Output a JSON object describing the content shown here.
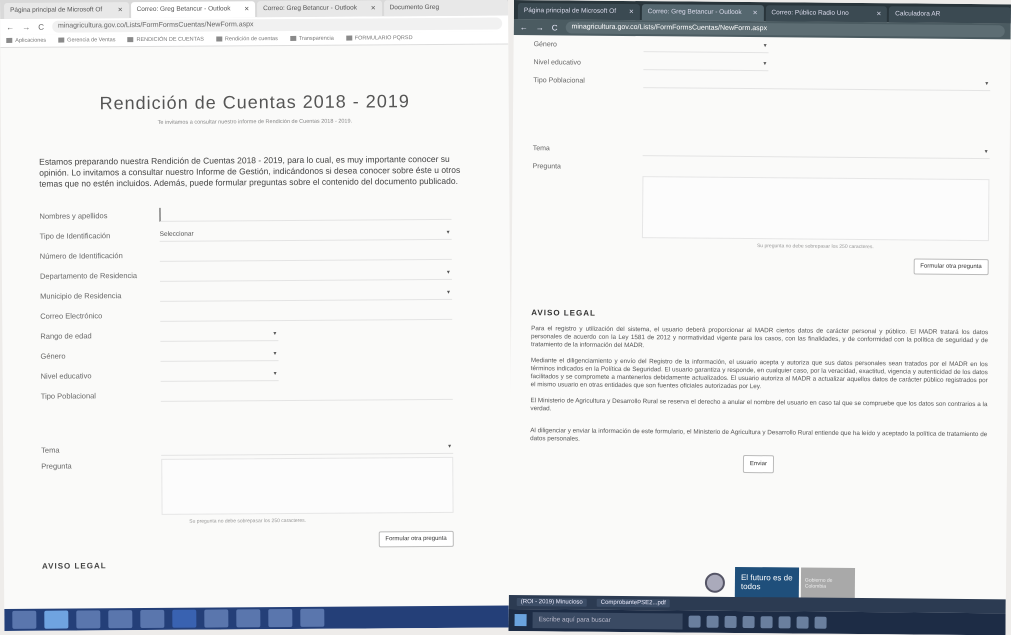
{
  "left": {
    "tabs": [
      {
        "label": "Página principal de Microsoft Of",
        "active": false
      },
      {
        "label": "Correo: Greg Betancur - Outlook",
        "active": true
      },
      {
        "label": "Correo: Greg Betancur - Outlook",
        "active": false
      },
      {
        "label": "Documento Greg",
        "active": false
      }
    ],
    "url": "minagricultura.gov.co/Lists/FormFormsCuentas/NewForm.aspx",
    "bookmarks": [
      "Aplicaciones",
      "Gerencia de Ventas",
      "RENDICIÓN DE CUENTAS",
      "Rendición de cuentas",
      "Transparencia",
      "FORMULARIO PQRSD"
    ],
    "title": "Rendición de Cuentas 2018 - 2019",
    "subtitle": "Te invitamos a consultar nuestro informe de Rendición de Cuentas 2018 - 2019.",
    "intro": "Estamos preparando nuestra Rendición de Cuentas 2018 - 2019, para lo cual, es muy importante conocer su opinión. Lo invitamos a consultar nuestro Informe de Gestión, indicándonos si desea conocer sobre éste u otros temas que no estén incluidos. Además, puede formular preguntas sobre el contenido del documento publicado.",
    "fields": [
      {
        "label": "Nombres y apellidos",
        "value": ""
      },
      {
        "label": "Tipo de Identificación",
        "value": "Seleccionar"
      },
      {
        "label": "Número de Identificación",
        "value": ""
      },
      {
        "label": "Departamento de Residencia",
        "value": ""
      },
      {
        "label": "Municipio de Residencia",
        "value": ""
      },
      {
        "label": "Correo Electrónico",
        "value": ""
      },
      {
        "label": "Rango de edad",
        "value": ""
      },
      {
        "label": "Género",
        "value": ""
      },
      {
        "label": "Nivel educativo",
        "value": ""
      },
      {
        "label": "Tipo Poblacional",
        "value": ""
      }
    ],
    "tema_label": "Tema",
    "pregunta_label": "Pregunta",
    "counter": "Su pregunta no debe sobrepasar los 250 caracteres.",
    "formular_button": "Formular otra pregunta",
    "aviso": "AVISO LEGAL"
  },
  "right": {
    "tabs": [
      {
        "label": "Página principal de Microsoft Of",
        "active": false
      },
      {
        "label": "Correo: Greg Betancur - Outlook",
        "active": true
      },
      {
        "label": "Correo: Público Radio Uno",
        "active": false
      },
      {
        "label": "Calculadora AR",
        "active": false
      }
    ],
    "url": "minagricultura.gov.co/Lists/FormFormsCuentas/NewForm.aspx",
    "fields": [
      {
        "label": "Género",
        "value": ""
      },
      {
        "label": "Nivel educativo",
        "value": ""
      },
      {
        "label": "Tipo Poblacional",
        "value": ""
      }
    ],
    "tema_label": "Tema",
    "pregunta_label": "Pregunta",
    "counter": "Su pregunta no debe sobrepasar los 250 caracteres.",
    "formular_button": "Formular otra pregunta",
    "legal_title": "AVISO LEGAL",
    "legal_p1": "Para el registro y utilización del sistema, el usuario deberá proporcionar al MADR ciertos datos de carácter personal y público. El MADR tratará los datos personales de acuerdo con la Ley 1581 de 2012 y normatividad vigente para los casos, con las finalidades, y de conformidad con la política de seguridad y de tratamiento de la información del MADR.",
    "legal_p2": "Mediante el diligenciamiento y envío del Registro de la información, el usuario acepta y autoriza que sus datos personales sean tratados por el MADR en los términos indicados en la Política de Seguridad. El usuario garantiza y responde, en cualquier caso, por la veracidad, exactitud, vigencia y autenticidad de los datos facilitados y se compromete a mantenerlos debidamente actualizados. El usuario autoriza al MADR a actualizar aquellos datos de carácter público registrados por el mismo usuario en otras entidades que son fuentes oficiales autorizadas por Ley.",
    "legal_p3": "El Ministerio de Agricultura y Desarrollo Rural se reserva el derecho a anular el nombre del usuario en caso tal que se compruebe que los datos son contrarios a la verdad.",
    "legal_p4": "Al diligenciar y enviar la información de este formulario, el Ministerio de Agricultura y Desarrollo Rural entiende que ha leído y aceptado la política de tratamiento de datos personales.",
    "send_button": "Enviar",
    "slogan": "El futuro es de todos",
    "ministry": "Gobierno de Colombia",
    "downloads": [
      "(ROI - 2019) Minucioso",
      "ComprobantePSE2...pdf"
    ],
    "taskbar_search": "Escribe aquí para buscar"
  }
}
